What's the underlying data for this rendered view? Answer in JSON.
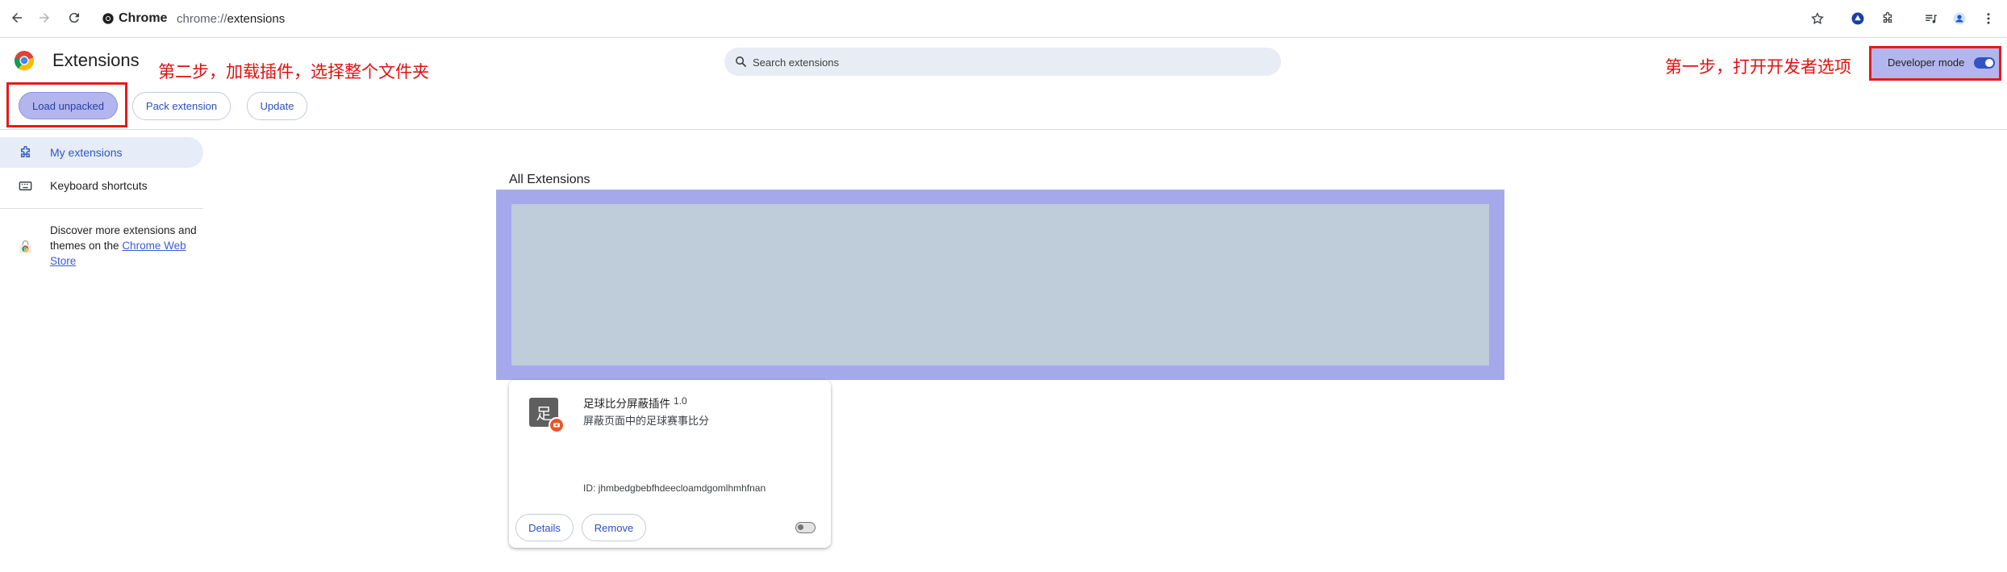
{
  "browser": {
    "chip_label": "Chrome",
    "url_scheme": "chrome://",
    "url_host": "extensions"
  },
  "page": {
    "title": "Extensions",
    "search_placeholder": "Search extensions",
    "developer_mode_label": "Developer mode",
    "developer_mode_on": true
  },
  "annotations": {
    "step1": "第一步，打开开发者选项",
    "step2": "第二步，加载插件，选择整个文件夹",
    "color": "#e31b1b"
  },
  "actions": {
    "load_unpacked": "Load unpacked",
    "pack_extension": "Pack extension",
    "update": "Update"
  },
  "sidebar": {
    "items": [
      {
        "label": "My extensions",
        "icon": "puzzle-icon",
        "selected": true
      },
      {
        "label": "Keyboard shortcuts",
        "icon": "keyboard-icon",
        "selected": false
      }
    ],
    "discover_text": "Discover more extensions and themes on the ",
    "discover_link": "Chrome Web Store"
  },
  "main": {
    "section_title": "All Extensions",
    "extension": {
      "icon_glyph": "足",
      "name": "足球比分屏蔽插件",
      "version": "1.0",
      "description": "屏蔽页面中的足球赛事比分",
      "id": "ID: jhmbedgbebfhdeecloamdgomlhmhfnan",
      "details_label": "Details",
      "remove_label": "Remove",
      "enabled": false
    }
  },
  "colors": {
    "accent": "#3153c5",
    "highlight": "#a6a8ec",
    "annotation": "#e31b1b"
  }
}
